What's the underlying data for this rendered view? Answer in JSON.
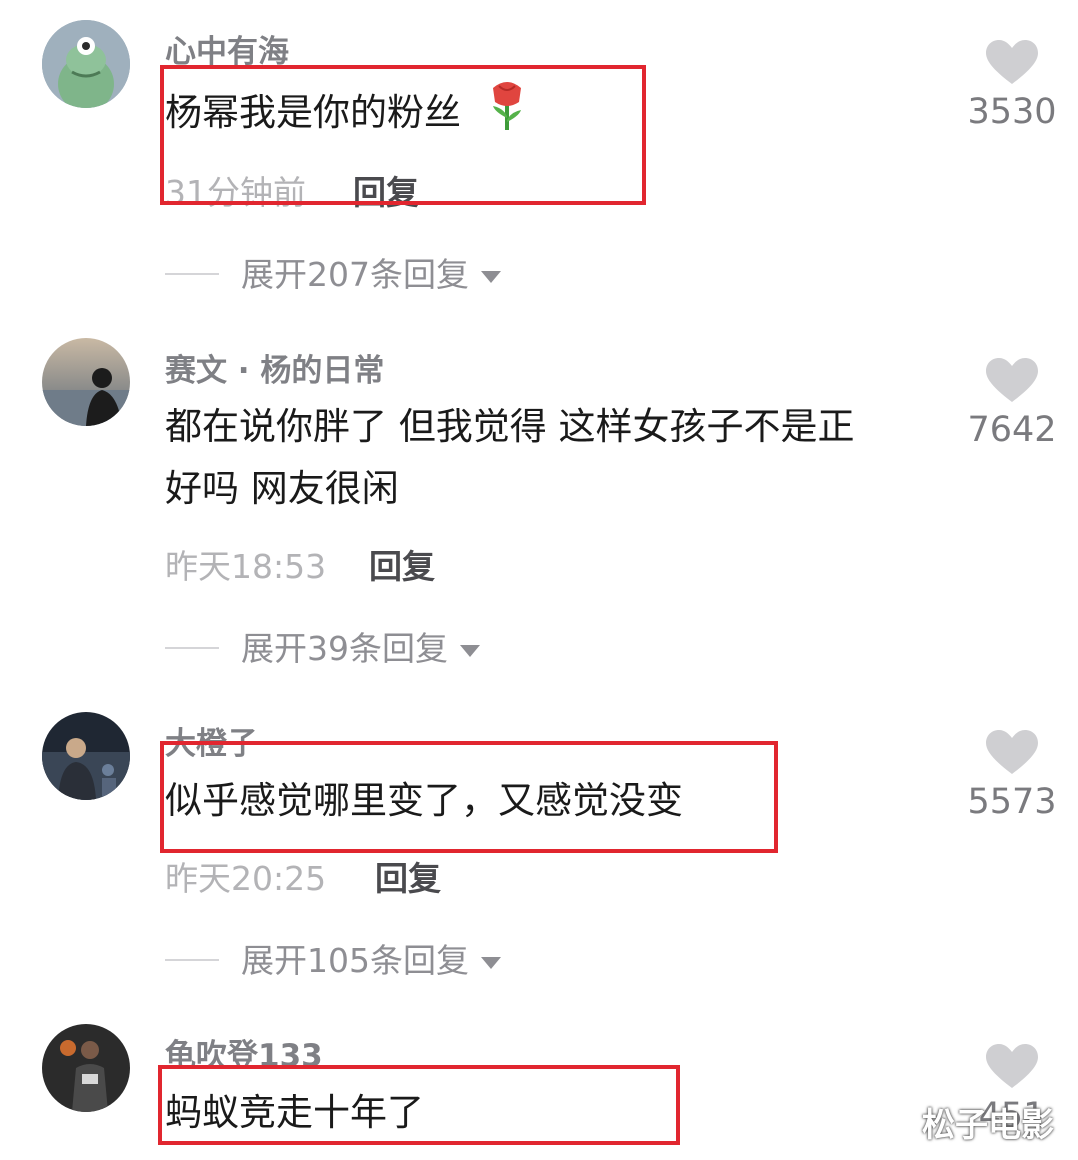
{
  "comments": [
    {
      "username": "心中有海",
      "text": "杨幂我是你的粉丝",
      "emoji": "rose-emoji",
      "time": "31分钟前",
      "reply_label": "回复",
      "expand_label": "展开207条回复",
      "likes": "3530"
    },
    {
      "username": "赛文 · 杨的日常",
      "text_line1": "都在说你胖了 但我觉得 这样女孩子不是正",
      "text_line2": "好吗 网友很闲",
      "time": "昨天18:53",
      "reply_label": "回复",
      "expand_label": "展开39条回复",
      "likes": "7642"
    },
    {
      "username": "大橙子",
      "text": "似乎感觉哪里变了，又感觉没变",
      "time": "昨天20:25",
      "reply_label": "回复",
      "expand_label": "展开105条回复",
      "likes": "5573"
    },
    {
      "username": "龟吹登133",
      "text": "蚂蚁竞走十年了",
      "likes": "451"
    }
  ],
  "watermark": "松子电影",
  "colors": {
    "highlight_box": "#e1262f",
    "heart": "#cfcfd2"
  }
}
